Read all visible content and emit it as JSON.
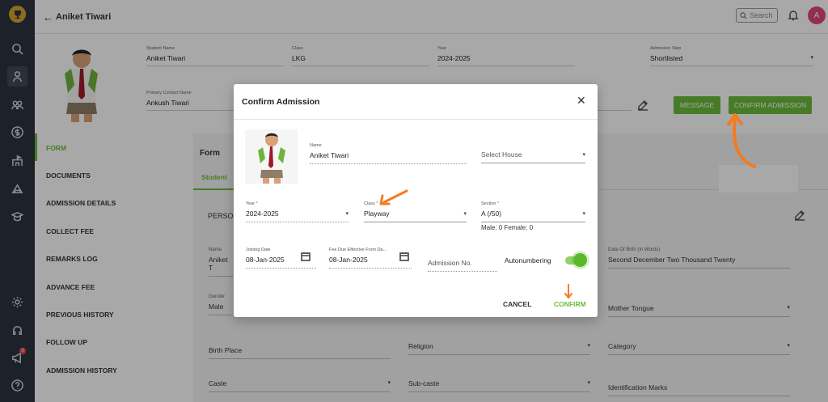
{
  "topbar": {
    "title": "Aniket Tiwari",
    "search_placeholder": "Search",
    "avatar_initial": "A"
  },
  "header": {
    "student_name_label": "Student Name",
    "student_name": "Aniket Tiwari",
    "class_label": "Class",
    "class_value": "LKG",
    "year_label": "Year",
    "year_value": "2024-2025",
    "admission_step_label": "Admission Step",
    "admission_step_value": "Shortlisted",
    "primary_contact_label": "Primary Contact Name",
    "primary_contact_value": "Ankush Tiwari",
    "message_button": "MESSAGE",
    "confirm_admission_button": "CONFIRM ADMISSION"
  },
  "sidenav": {
    "items": [
      {
        "label": "FORM",
        "active": true
      },
      {
        "label": "DOCUMENTS"
      },
      {
        "label": "ADMISSION DETAILS"
      },
      {
        "label": "COLLECT FEE"
      },
      {
        "label": "REMARKS LOG"
      },
      {
        "label": "ADVANCE FEE"
      },
      {
        "label": "PREVIOUS HISTORY"
      },
      {
        "label": "FOLLOW UP"
      },
      {
        "label": "ADMISSION HISTORY"
      }
    ]
  },
  "rail": {
    "notification_count": "0"
  },
  "main": {
    "form_title": "Form",
    "tab_student": "Student",
    "section_title": "PERSON",
    "name_label": "Name",
    "name_value": "Aniket T",
    "dob_words_label": "Date Of Birth (In Words)",
    "dob_words_value": "Second December  Two Thousand Twenty",
    "gender_label": "Gender",
    "gender_value": "Male",
    "mother_tongue": "Mother Tongue",
    "birth_place": "Birth Place",
    "religion": "Religion",
    "category": "Category",
    "caste": "Caste",
    "sub_caste": "Sub-caste",
    "identification_marks": "Identification Marks"
  },
  "modal": {
    "title": "Confirm Admission",
    "name_label": "Name",
    "name_value": "Aniket Tiwari",
    "house_placeholder": "Select House",
    "year_label": "Year",
    "year_value": "2024-2025",
    "class_label": "Class",
    "class_value": "Playway",
    "section_label": "Section",
    "section_value": "A (/50)",
    "gender_count": "Male: 0 Female: 0",
    "joining_date_label": "Joining Date",
    "joining_date_value": "08-Jan-2025",
    "fee_due_label": "Fee Due Effective From Da...",
    "fee_due_value": "08-Jan-2025",
    "admission_no_placeholder": "Admission No.",
    "autonumbering_label": "Autonumbering",
    "autonumbering_on": true,
    "cancel_button": "CANCEL",
    "confirm_button": "CONFIRM"
  },
  "colors": {
    "accent_green": "#6cbd3a",
    "rail_dark": "#2c3440",
    "annotation_orange": "#f47b20",
    "avatar_pink": "#e0457b"
  }
}
